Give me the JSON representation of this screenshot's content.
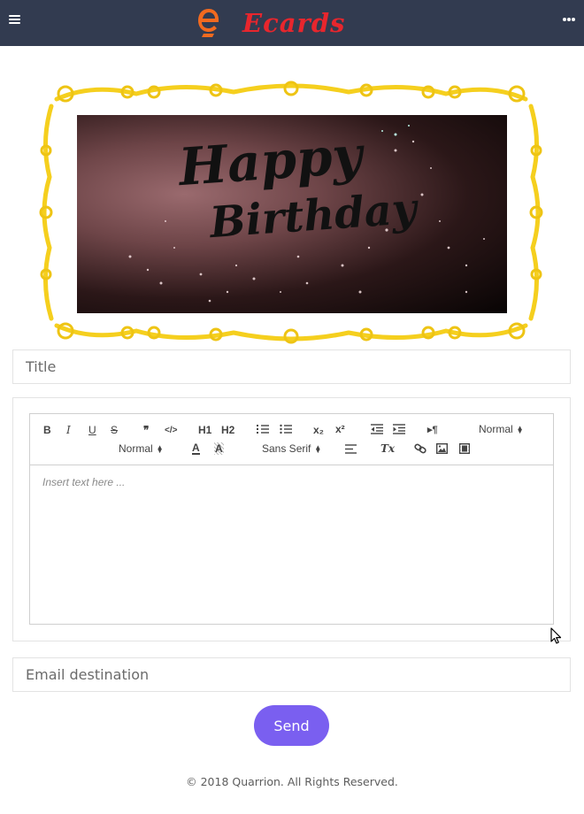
{
  "header": {
    "menu_icon": "hamburger-icon",
    "logo_text": "Ecards",
    "more_icon": "more-dots-icon",
    "background": "#323b50",
    "logo_color": "#e8262d"
  },
  "card": {
    "image_text_line1": "Happy",
    "image_text_line2": "Birthday",
    "frame_color": "#f5cf1e"
  },
  "form": {
    "title_placeholder": "Title",
    "email_placeholder": "Email destination",
    "send_label": "Send",
    "send_color": "#7a5ff0"
  },
  "editor": {
    "placeholder": "Insert text here ...",
    "header_select": "Normal",
    "size_select": "Normal",
    "font_select": "Sans Serif",
    "bold_label": "B",
    "italic_label": "I",
    "underline_label": "U",
    "strike_label": "S",
    "quote_label": "❞",
    "code_label": "</>",
    "h1_label": "H1",
    "h2_label": "H2",
    "sub_label": "x₂",
    "sup_label": "x²",
    "rtl_label": "▸¶",
    "color_label": "A",
    "background_label": "A",
    "clean_label": "Tx"
  },
  "footer": {
    "text": "© 2018 Quarrion. All Rights Reserved."
  }
}
